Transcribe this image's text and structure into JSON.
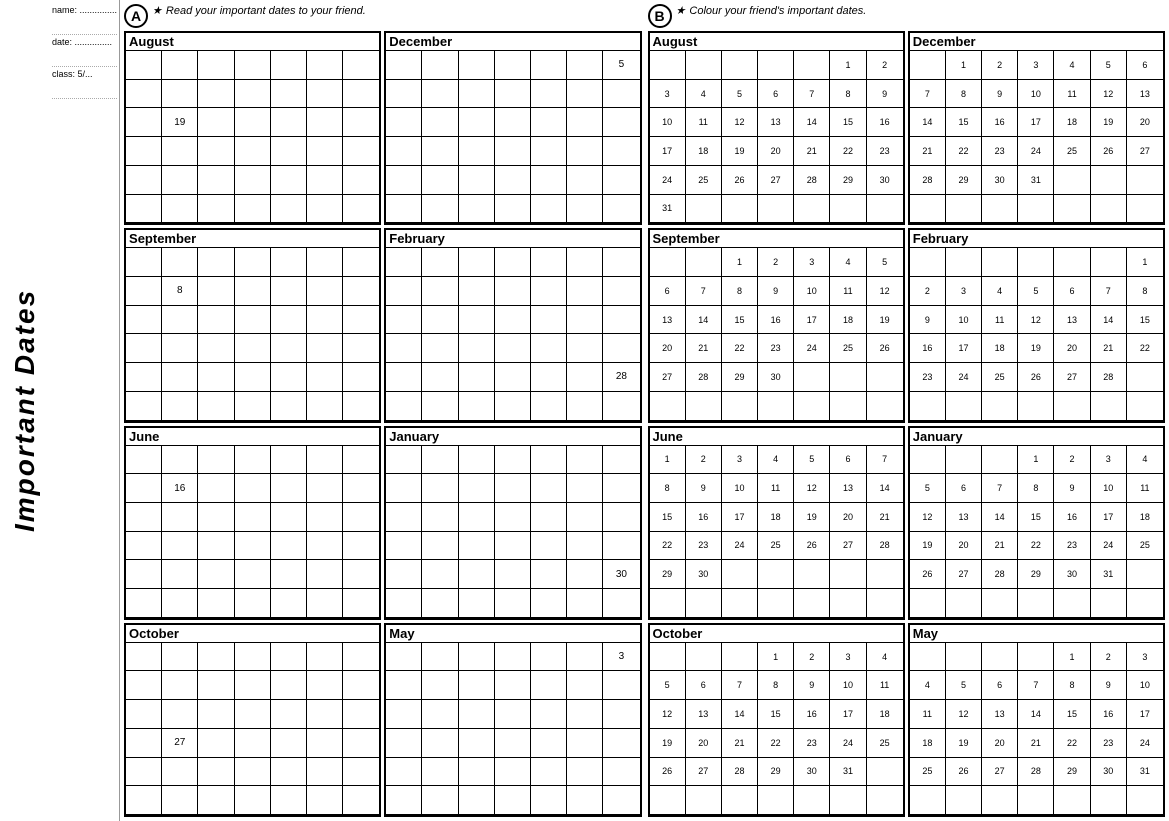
{
  "vertical_label": "Important Dates",
  "side_meta": {
    "name_label": "name:",
    "date_label": "date:",
    "class_label": "class: 5/..."
  },
  "section_a": {
    "circle": "A",
    "instruction_star": "★",
    "instruction_text": "Read your important dates to your friend.",
    "calendars": [
      {
        "id": "aug-a",
        "month": "August",
        "rows": 6,
        "cols": 7,
        "special_cells": [
          {
            "row": 3,
            "col": 2,
            "value": "19"
          }
        ]
      },
      {
        "id": "dec-a",
        "month": "December",
        "rows": 6,
        "cols": 7,
        "special_cells": [
          {
            "row": 1,
            "col": 7,
            "value": "5"
          }
        ]
      },
      {
        "id": "sep-a",
        "month": "September",
        "rows": 6,
        "cols": 7,
        "special_cells": [
          {
            "row": 2,
            "col": 2,
            "value": "8"
          }
        ]
      },
      {
        "id": "feb-a",
        "month": "February",
        "rows": 6,
        "cols": 7,
        "special_cells": [
          {
            "row": 5,
            "col": 7,
            "value": "28"
          }
        ]
      },
      {
        "id": "jun-a",
        "month": "June",
        "rows": 6,
        "cols": 7,
        "special_cells": [
          {
            "row": 2,
            "col": 2,
            "value": "16"
          }
        ]
      },
      {
        "id": "jan-a",
        "month": "January",
        "rows": 6,
        "cols": 7,
        "special_cells": [
          {
            "row": 5,
            "col": 7,
            "value": "30"
          }
        ]
      },
      {
        "id": "oct-a",
        "month": "October",
        "rows": 6,
        "cols": 7,
        "special_cells": [
          {
            "row": 4,
            "col": 2,
            "value": "27"
          }
        ]
      },
      {
        "id": "may-a",
        "month": "May",
        "rows": 6,
        "cols": 7,
        "special_cells": [
          {
            "row": 1,
            "col": 7,
            "value": "3"
          }
        ]
      }
    ]
  },
  "section_b": {
    "circle": "B",
    "instruction_star": "★",
    "instruction_text": "Colour your friend's important dates.",
    "calendars": [
      {
        "id": "aug-b",
        "month": "August",
        "cells": [
          "",
          "",
          "",
          "",
          "",
          "1",
          "2",
          "3",
          "4",
          "5",
          "6",
          "7",
          "8",
          "9",
          "10",
          "11",
          "12",
          "13",
          "14",
          "15",
          "16",
          "17",
          "18",
          "19",
          "20",
          "21",
          "22",
          "23",
          "24",
          "25",
          "26",
          "27",
          "28",
          "29",
          "30",
          "31",
          "",
          "",
          "",
          "",
          "",
          "",
          ""
        ]
      },
      {
        "id": "dec-b",
        "month": "December",
        "cells": [
          "",
          "1",
          "2",
          "3",
          "4",
          "5",
          "6",
          "7",
          "8",
          "9",
          "10",
          "11",
          "12",
          "13",
          "14",
          "15",
          "16",
          "17",
          "18",
          "19",
          "20",
          "21",
          "22",
          "23",
          "24",
          "25",
          "26",
          "27",
          "28",
          "29",
          "30",
          "31",
          "",
          "",
          "",
          "",
          "",
          "",
          "",
          "",
          "",
          ""
        ]
      },
      {
        "id": "sep-b",
        "month": "September",
        "cells": [
          "",
          "",
          "1",
          "2",
          "3",
          "4",
          "5",
          "6",
          "7",
          "8",
          "9",
          "10",
          "11",
          "12",
          "13",
          "14",
          "15",
          "16",
          "17",
          "18",
          "19",
          "20",
          "21",
          "22",
          "23",
          "24",
          "25",
          "26",
          "27",
          "28",
          "29",
          "30",
          "",
          "",
          "",
          "",
          "",
          "",
          "",
          "",
          "",
          ""
        ]
      },
      {
        "id": "feb-b",
        "month": "February",
        "cells": [
          "",
          "",
          "",
          "",
          "",
          "",
          "1",
          "2",
          "3",
          "4",
          "5",
          "6",
          "7",
          "8",
          "9",
          "10",
          "11",
          "12",
          "13",
          "14",
          "15",
          "16",
          "17",
          "18",
          "19",
          "20",
          "21",
          "22",
          "23",
          "24",
          "25",
          "26",
          "27",
          "28",
          "",
          "",
          "",
          "",
          "",
          "",
          "",
          ""
        ]
      },
      {
        "id": "jun-b",
        "month": "June",
        "cells": [
          "1",
          "2",
          "3",
          "4",
          "5",
          "6",
          "7",
          "8",
          "9",
          "10",
          "11",
          "12",
          "13",
          "14",
          "15",
          "16",
          "17",
          "18",
          "19",
          "20",
          "21",
          "22",
          "23",
          "24",
          "25",
          "26",
          "27",
          "28",
          "29",
          "30",
          "",
          "",
          "",
          "",
          "",
          "",
          "",
          "",
          "",
          "",
          "",
          ""
        ]
      },
      {
        "id": "jan-b",
        "month": "January",
        "cells": [
          "",
          "",
          "",
          "1",
          "2",
          "3",
          "4",
          "5",
          "6",
          "7",
          "8",
          "9",
          "10",
          "11",
          "12",
          "13",
          "14",
          "15",
          "16",
          "17",
          "18",
          "19",
          "20",
          "21",
          "22",
          "23",
          "24",
          "25",
          "26",
          "27",
          "28",
          "29",
          "30",
          "31",
          "",
          "",
          "",
          "",
          "",
          "",
          "",
          ""
        ]
      },
      {
        "id": "oct-b",
        "month": "October",
        "cells": [
          "",
          "",
          "",
          "1",
          "2",
          "3",
          "4",
          "5",
          "6",
          "7",
          "8",
          "9",
          "10",
          "11",
          "12",
          "13",
          "14",
          "15",
          "16",
          "17",
          "18",
          "19",
          "20",
          "21",
          "22",
          "23",
          "24",
          "25",
          "26",
          "27",
          "28",
          "29",
          "30",
          "31",
          "",
          "",
          "",
          "",
          "",
          "",
          "",
          ""
        ]
      },
      {
        "id": "may-b",
        "month": "May",
        "cells": [
          "",
          "",
          "",
          "",
          "1",
          "2",
          "3",
          "4",
          "5",
          "6",
          "7",
          "8",
          "9",
          "10",
          "11",
          "12",
          "13",
          "14",
          "15",
          "16",
          "17",
          "18",
          "19",
          "20",
          "21",
          "22",
          "23",
          "24",
          "25",
          "26",
          "27",
          "28",
          "29",
          "30",
          "31",
          "",
          "",
          "",
          "",
          "",
          "",
          "",
          ""
        ]
      }
    ]
  }
}
